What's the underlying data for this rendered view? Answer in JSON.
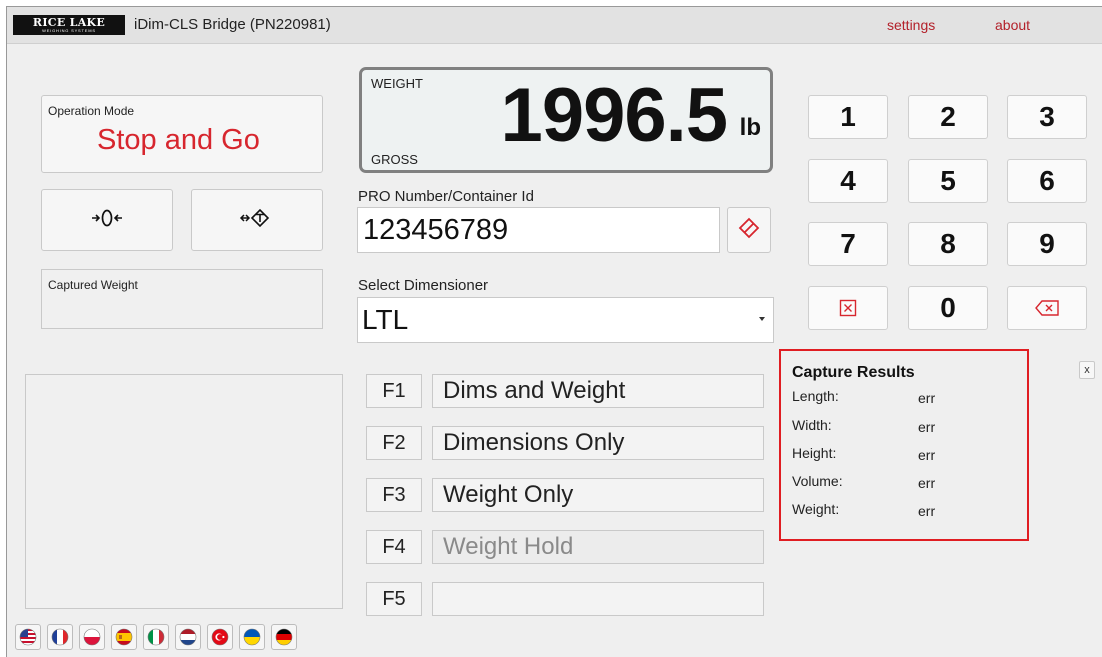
{
  "header": {
    "logo_main": "RICE LAKE",
    "logo_sub": "WEIGHING SYSTEMS",
    "title": "iDim-CLS Bridge (PN220981)",
    "menu": [
      {
        "label": "settings"
      },
      {
        "label": "about"
      }
    ]
  },
  "operation_mode": {
    "label": "Operation Mode",
    "value": "Stop and Go"
  },
  "captured_weight": {
    "label": "Captured Weight",
    "value": ""
  },
  "weight_display": {
    "label": "WEIGHT",
    "mode": "GROSS",
    "value": "1996.5",
    "unit": "lb"
  },
  "pro_number": {
    "label": "PRO Number/Container Id",
    "value": "123456789"
  },
  "dimensioner": {
    "label": "Select Dimensioner",
    "selected": "LTL"
  },
  "function_keys": [
    {
      "key": "F1",
      "label": "Dims and Weight"
    },
    {
      "key": "F2",
      "label": "Dimensions Only"
    },
    {
      "key": "F3",
      "label": "Weight Only"
    },
    {
      "key": "F4",
      "label": "Weight Hold"
    },
    {
      "key": "F5",
      "label": ""
    }
  ],
  "keypad": {
    "keys": [
      "1",
      "2",
      "3",
      "4",
      "5",
      "6",
      "7",
      "8",
      "9",
      "0"
    ]
  },
  "capture_results": {
    "title": "Capture Results",
    "close_label": "x",
    "rows": [
      {
        "label": "Length:",
        "value": "err"
      },
      {
        "label": "Width:",
        "value": "err"
      },
      {
        "label": "Height:",
        "value": "err"
      },
      {
        "label": "Volume:",
        "value": "err"
      },
      {
        "label": "Weight:",
        "value": "err"
      }
    ]
  },
  "languages": [
    "english-us",
    "french",
    "polish",
    "spanish",
    "italian",
    "dutch",
    "turkish",
    "ukrainian",
    "german"
  ],
  "colors": {
    "accent_red": "#d7262e",
    "results_border": "#e01d22",
    "menu_link": "#b3202a"
  }
}
